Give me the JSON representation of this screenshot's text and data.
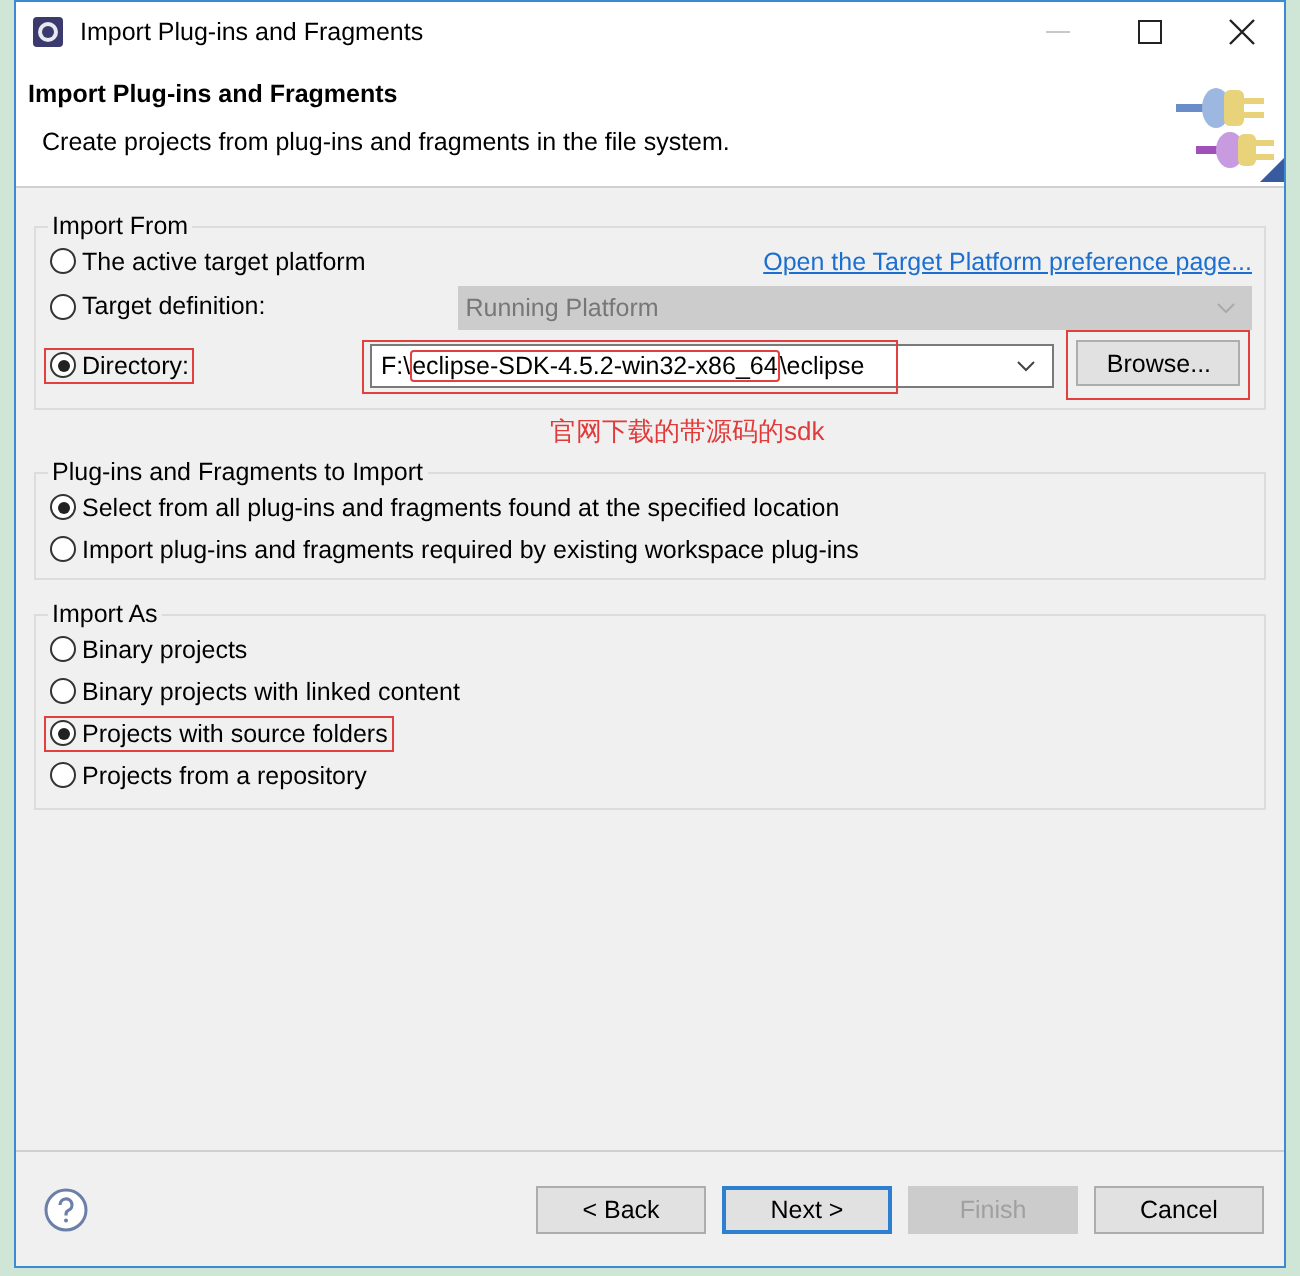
{
  "window": {
    "title": "Import Plug-ins and Fragments",
    "controls": [
      {
        "kind": "minimize",
        "disabled": true
      },
      {
        "kind": "maximize",
        "disabled": false
      },
      {
        "kind": "close",
        "disabled": false
      }
    ]
  },
  "header": {
    "title": "Import Plug-ins and Fragments",
    "description": "Create projects from plug-ins and fragments in the file system."
  },
  "import_from": {
    "legend": "Import From",
    "link": "Open the Target Platform preference page...",
    "options": [
      {
        "kind": "plain",
        "label": "The active target platform",
        "selected": false,
        "highlighted": false
      },
      {
        "kind": "combo",
        "label": "Target definition:",
        "selected": false,
        "highlighted": false,
        "combo": {
          "value": "Running Platform",
          "disabled": true
        }
      },
      {
        "kind": "path",
        "label": "Directory:",
        "selected": true,
        "highlighted": true,
        "path": {
          "prefix": "F:\\",
          "marked": "eclipse-SDK-4.5.2-win32-x86_64",
          "suffix": "\\eclipse",
          "highlighted": true
        },
        "browse": {
          "label": "Browse...",
          "highlighted": true
        }
      }
    ]
  },
  "annotation": "官网下载的带源码的sdk",
  "to_import": {
    "legend": "Plug-ins and Fragments to Import",
    "options": [
      {
        "label": "Select from all plug-ins and fragments found at the specified location",
        "selected": true,
        "highlighted": false
      },
      {
        "label": "Import plug-ins and fragments required by existing workspace plug-ins",
        "selected": false,
        "highlighted": false
      }
    ]
  },
  "import_as": {
    "legend": "Import As",
    "options": [
      {
        "label": "Binary projects",
        "selected": false,
        "highlighted": false
      },
      {
        "label": "Binary projects with linked content",
        "selected": false,
        "highlighted": false
      },
      {
        "label": "Projects with source folders",
        "selected": true,
        "highlighted": true
      },
      {
        "label": "Projects from a repository",
        "selected": false,
        "highlighted": false
      }
    ]
  },
  "buttons": [
    {
      "label": "< Back",
      "disabled": false,
      "default": false
    },
    {
      "label": "Next >",
      "disabled": false,
      "default": true
    },
    {
      "label": "Finish",
      "disabled": true,
      "default": false
    },
    {
      "label": "Cancel",
      "disabled": false,
      "default": false
    }
  ]
}
